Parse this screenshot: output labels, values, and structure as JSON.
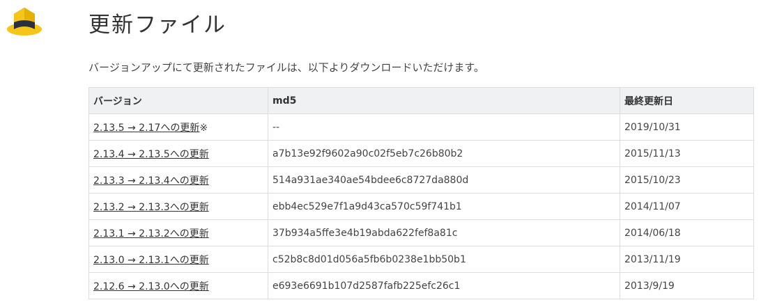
{
  "page": {
    "title": "更新ファイル",
    "intro": "バージョンアップにて更新されたファイルは、以下よりダウンロードいただけます。"
  },
  "table": {
    "headers": [
      "バージョン",
      "md5",
      "最終更新日"
    ],
    "rows": [
      {
        "version": "2.13.5 → 2.17への更新",
        "note": "※",
        "md5": "--",
        "date": "2019/10/31"
      },
      {
        "version": "2.13.4 → 2.13.5への更新",
        "note": "",
        "md5": "a7b13e92f9602a90c02f5eb7c26b80b2",
        "date": "2015/11/13"
      },
      {
        "version": "2.13.3 → 2.13.4への更新",
        "note": "",
        "md5": "514a931ae340ae54bdee6c8727da880d",
        "date": "2015/10/23"
      },
      {
        "version": "2.13.2 → 2.13.3への更新",
        "note": "",
        "md5": "ebb4ec529e7f1a9d43ca570c59f741b1",
        "date": "2014/11/07"
      },
      {
        "version": "2.13.1 → 2.13.2への更新",
        "note": "",
        "md5": "37b934a5ffe3e4b19abda622fef8a81c",
        "date": "2014/06/18"
      },
      {
        "version": "2.13.0 → 2.13.1への更新",
        "note": "",
        "md5": "c52b8c8d01d056a5fb6b0238e1bb50b1",
        "date": "2013/11/19"
      },
      {
        "version": "2.12.6 → 2.13.0への更新",
        "note": "",
        "md5": "e693e6691b107d2587fafb225efc26c1",
        "date": "2013/9/19"
      }
    ]
  },
  "colors": {
    "logo_yellow": "#f5c518",
    "logo_dark": "#2b3040",
    "header_bg": "#f0f1f3"
  }
}
